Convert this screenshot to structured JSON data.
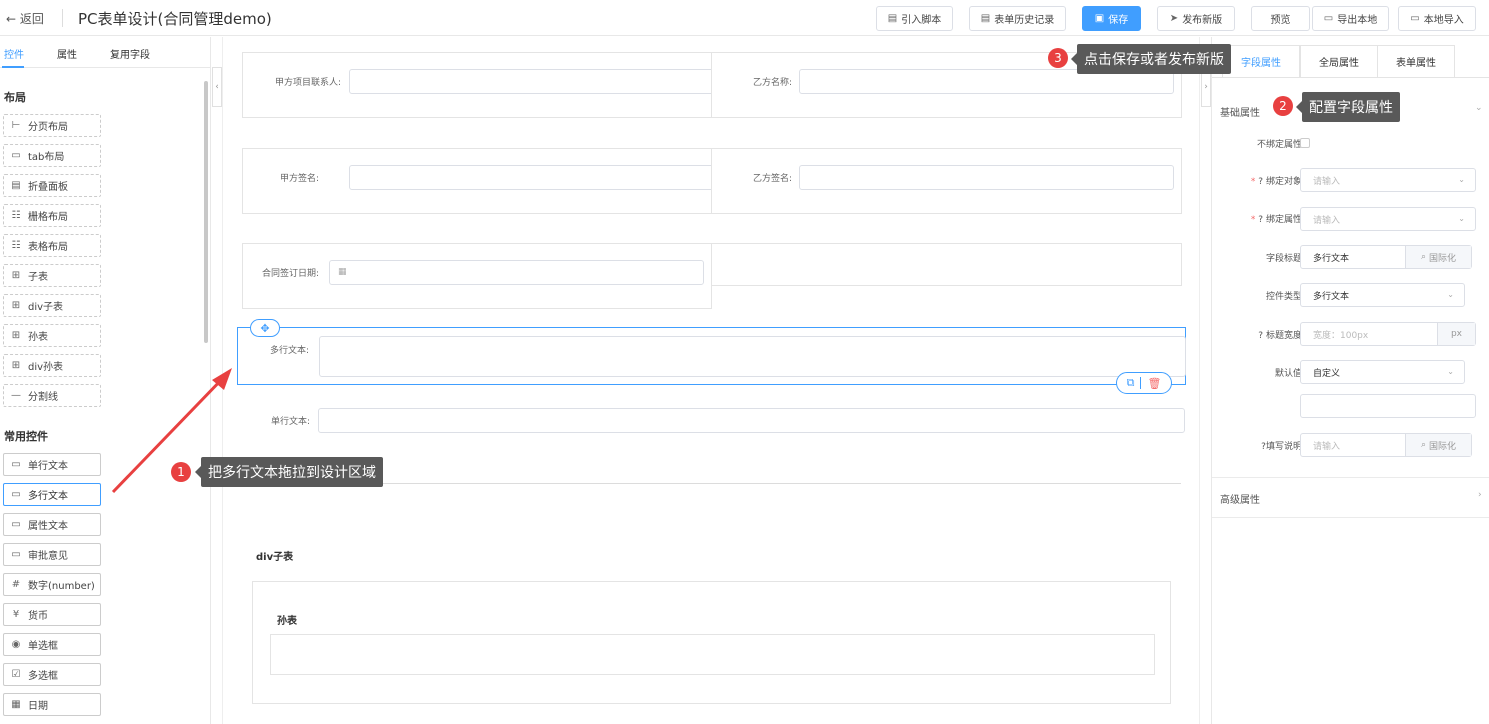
{
  "header": {
    "back_label": "返回",
    "title": "PC表单设计(合同管理demo)",
    "buttons": {
      "import_script": "引入脚本",
      "history": "表单历史记录",
      "save": "保存",
      "publish": "发布新版",
      "preview": "预览",
      "export_local": "导出本地",
      "import_local": "本地导入"
    }
  },
  "left": {
    "tabs": [
      "控件",
      "属性",
      "复用字段"
    ],
    "layout_title": "布局",
    "layout_items": [
      "分页布局",
      "tab布局",
      "折叠面板",
      "栅格布局",
      "表格布局",
      "子表",
      "div子表",
      "孙表",
      "div孙表",
      "分割线"
    ],
    "common_title": "常用控件",
    "common_items": [
      "单行文本",
      "多行文本",
      "属性文本",
      "审批意见",
      "数字(number)",
      "货币",
      "单选框",
      "多选框",
      "日期"
    ]
  },
  "canvas": {
    "fields": {
      "party_a_contact": "甲方项目联系人:",
      "party_b_name": "乙方名称:",
      "party_a_sign": "甲方签名:",
      "party_b_sign": "乙方签名:",
      "sign_date": "合同签订日期:",
      "multiline": "多行文本:",
      "singleline": "单行文本:"
    },
    "div_subtable_title": "div子表",
    "grandchild_title": "孙表"
  },
  "right": {
    "tabs": [
      "字段属性",
      "全局属性",
      "表单属性"
    ],
    "basic_title": "基础属性",
    "advanced_title": "高级属性",
    "props": {
      "unbound_label": "不绑定属性:",
      "bind_object_label": "绑定对象:",
      "bind_object_placeholder": "请输入",
      "bind_prop_label": "绑定属性:",
      "bind_prop_placeholder": "请输入",
      "field_title_label": "字段标题:",
      "field_title_value": "多行文本",
      "i18n_label": "国际化",
      "control_type_label": "控件类型:",
      "control_type_value": "多行文本",
      "title_width_label": "标题宽度:",
      "title_width_placeholder": "宽度：100px",
      "title_width_unit": "px",
      "default_label": "默认值:",
      "default_value": "自定义",
      "fill_note_label": "填写说明:",
      "fill_note_placeholder": "请输入",
      "required_mark": "*"
    }
  },
  "annotations": [
    {
      "num": "1",
      "text": "把多行文本拖拉到设计区域"
    },
    {
      "num": "2",
      "text": "配置字段属性"
    },
    {
      "num": "3",
      "text": "点击保存或者发布新版"
    }
  ],
  "colors": {
    "accent": "#409eff",
    "annotation_badge": "#e84040",
    "annotation_bg": "#595959",
    "arrow": "#e84040"
  }
}
